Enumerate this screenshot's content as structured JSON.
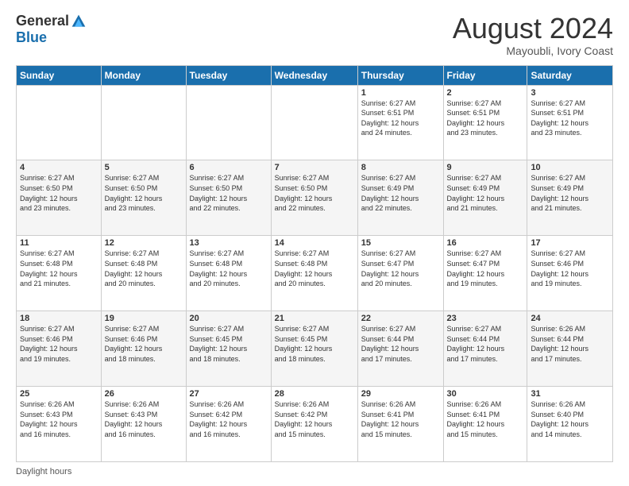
{
  "logo": {
    "general": "General",
    "blue": "Blue"
  },
  "header": {
    "month": "August 2024",
    "location": "Mayoubli, Ivory Coast"
  },
  "days_of_week": [
    "Sunday",
    "Monday",
    "Tuesday",
    "Wednesday",
    "Thursday",
    "Friday",
    "Saturday"
  ],
  "footer": {
    "daylight_hours": "Daylight hours"
  },
  "weeks": [
    [
      {
        "day": "",
        "info": ""
      },
      {
        "day": "",
        "info": ""
      },
      {
        "day": "",
        "info": ""
      },
      {
        "day": "",
        "info": ""
      },
      {
        "day": "1",
        "info": "Sunrise: 6:27 AM\nSunset: 6:51 PM\nDaylight: 12 hours\nand 24 minutes."
      },
      {
        "day": "2",
        "info": "Sunrise: 6:27 AM\nSunset: 6:51 PM\nDaylight: 12 hours\nand 23 minutes."
      },
      {
        "day": "3",
        "info": "Sunrise: 6:27 AM\nSunset: 6:51 PM\nDaylight: 12 hours\nand 23 minutes."
      }
    ],
    [
      {
        "day": "4",
        "info": "Sunrise: 6:27 AM\nSunset: 6:50 PM\nDaylight: 12 hours\nand 23 minutes."
      },
      {
        "day": "5",
        "info": "Sunrise: 6:27 AM\nSunset: 6:50 PM\nDaylight: 12 hours\nand 23 minutes."
      },
      {
        "day": "6",
        "info": "Sunrise: 6:27 AM\nSunset: 6:50 PM\nDaylight: 12 hours\nand 22 minutes."
      },
      {
        "day": "7",
        "info": "Sunrise: 6:27 AM\nSunset: 6:50 PM\nDaylight: 12 hours\nand 22 minutes."
      },
      {
        "day": "8",
        "info": "Sunrise: 6:27 AM\nSunset: 6:49 PM\nDaylight: 12 hours\nand 22 minutes."
      },
      {
        "day": "9",
        "info": "Sunrise: 6:27 AM\nSunset: 6:49 PM\nDaylight: 12 hours\nand 21 minutes."
      },
      {
        "day": "10",
        "info": "Sunrise: 6:27 AM\nSunset: 6:49 PM\nDaylight: 12 hours\nand 21 minutes."
      }
    ],
    [
      {
        "day": "11",
        "info": "Sunrise: 6:27 AM\nSunset: 6:48 PM\nDaylight: 12 hours\nand 21 minutes."
      },
      {
        "day": "12",
        "info": "Sunrise: 6:27 AM\nSunset: 6:48 PM\nDaylight: 12 hours\nand 20 minutes."
      },
      {
        "day": "13",
        "info": "Sunrise: 6:27 AM\nSunset: 6:48 PM\nDaylight: 12 hours\nand 20 minutes."
      },
      {
        "day": "14",
        "info": "Sunrise: 6:27 AM\nSunset: 6:48 PM\nDaylight: 12 hours\nand 20 minutes."
      },
      {
        "day": "15",
        "info": "Sunrise: 6:27 AM\nSunset: 6:47 PM\nDaylight: 12 hours\nand 20 minutes."
      },
      {
        "day": "16",
        "info": "Sunrise: 6:27 AM\nSunset: 6:47 PM\nDaylight: 12 hours\nand 19 minutes."
      },
      {
        "day": "17",
        "info": "Sunrise: 6:27 AM\nSunset: 6:46 PM\nDaylight: 12 hours\nand 19 minutes."
      }
    ],
    [
      {
        "day": "18",
        "info": "Sunrise: 6:27 AM\nSunset: 6:46 PM\nDaylight: 12 hours\nand 19 minutes."
      },
      {
        "day": "19",
        "info": "Sunrise: 6:27 AM\nSunset: 6:46 PM\nDaylight: 12 hours\nand 18 minutes."
      },
      {
        "day": "20",
        "info": "Sunrise: 6:27 AM\nSunset: 6:45 PM\nDaylight: 12 hours\nand 18 minutes."
      },
      {
        "day": "21",
        "info": "Sunrise: 6:27 AM\nSunset: 6:45 PM\nDaylight: 12 hours\nand 18 minutes."
      },
      {
        "day": "22",
        "info": "Sunrise: 6:27 AM\nSunset: 6:44 PM\nDaylight: 12 hours\nand 17 minutes."
      },
      {
        "day": "23",
        "info": "Sunrise: 6:27 AM\nSunset: 6:44 PM\nDaylight: 12 hours\nand 17 minutes."
      },
      {
        "day": "24",
        "info": "Sunrise: 6:26 AM\nSunset: 6:44 PM\nDaylight: 12 hours\nand 17 minutes."
      }
    ],
    [
      {
        "day": "25",
        "info": "Sunrise: 6:26 AM\nSunset: 6:43 PM\nDaylight: 12 hours\nand 16 minutes."
      },
      {
        "day": "26",
        "info": "Sunrise: 6:26 AM\nSunset: 6:43 PM\nDaylight: 12 hours\nand 16 minutes."
      },
      {
        "day": "27",
        "info": "Sunrise: 6:26 AM\nSunset: 6:42 PM\nDaylight: 12 hours\nand 16 minutes."
      },
      {
        "day": "28",
        "info": "Sunrise: 6:26 AM\nSunset: 6:42 PM\nDaylight: 12 hours\nand 15 minutes."
      },
      {
        "day": "29",
        "info": "Sunrise: 6:26 AM\nSunset: 6:41 PM\nDaylight: 12 hours\nand 15 minutes."
      },
      {
        "day": "30",
        "info": "Sunrise: 6:26 AM\nSunset: 6:41 PM\nDaylight: 12 hours\nand 15 minutes."
      },
      {
        "day": "31",
        "info": "Sunrise: 6:26 AM\nSunset: 6:40 PM\nDaylight: 12 hours\nand 14 minutes."
      }
    ]
  ]
}
